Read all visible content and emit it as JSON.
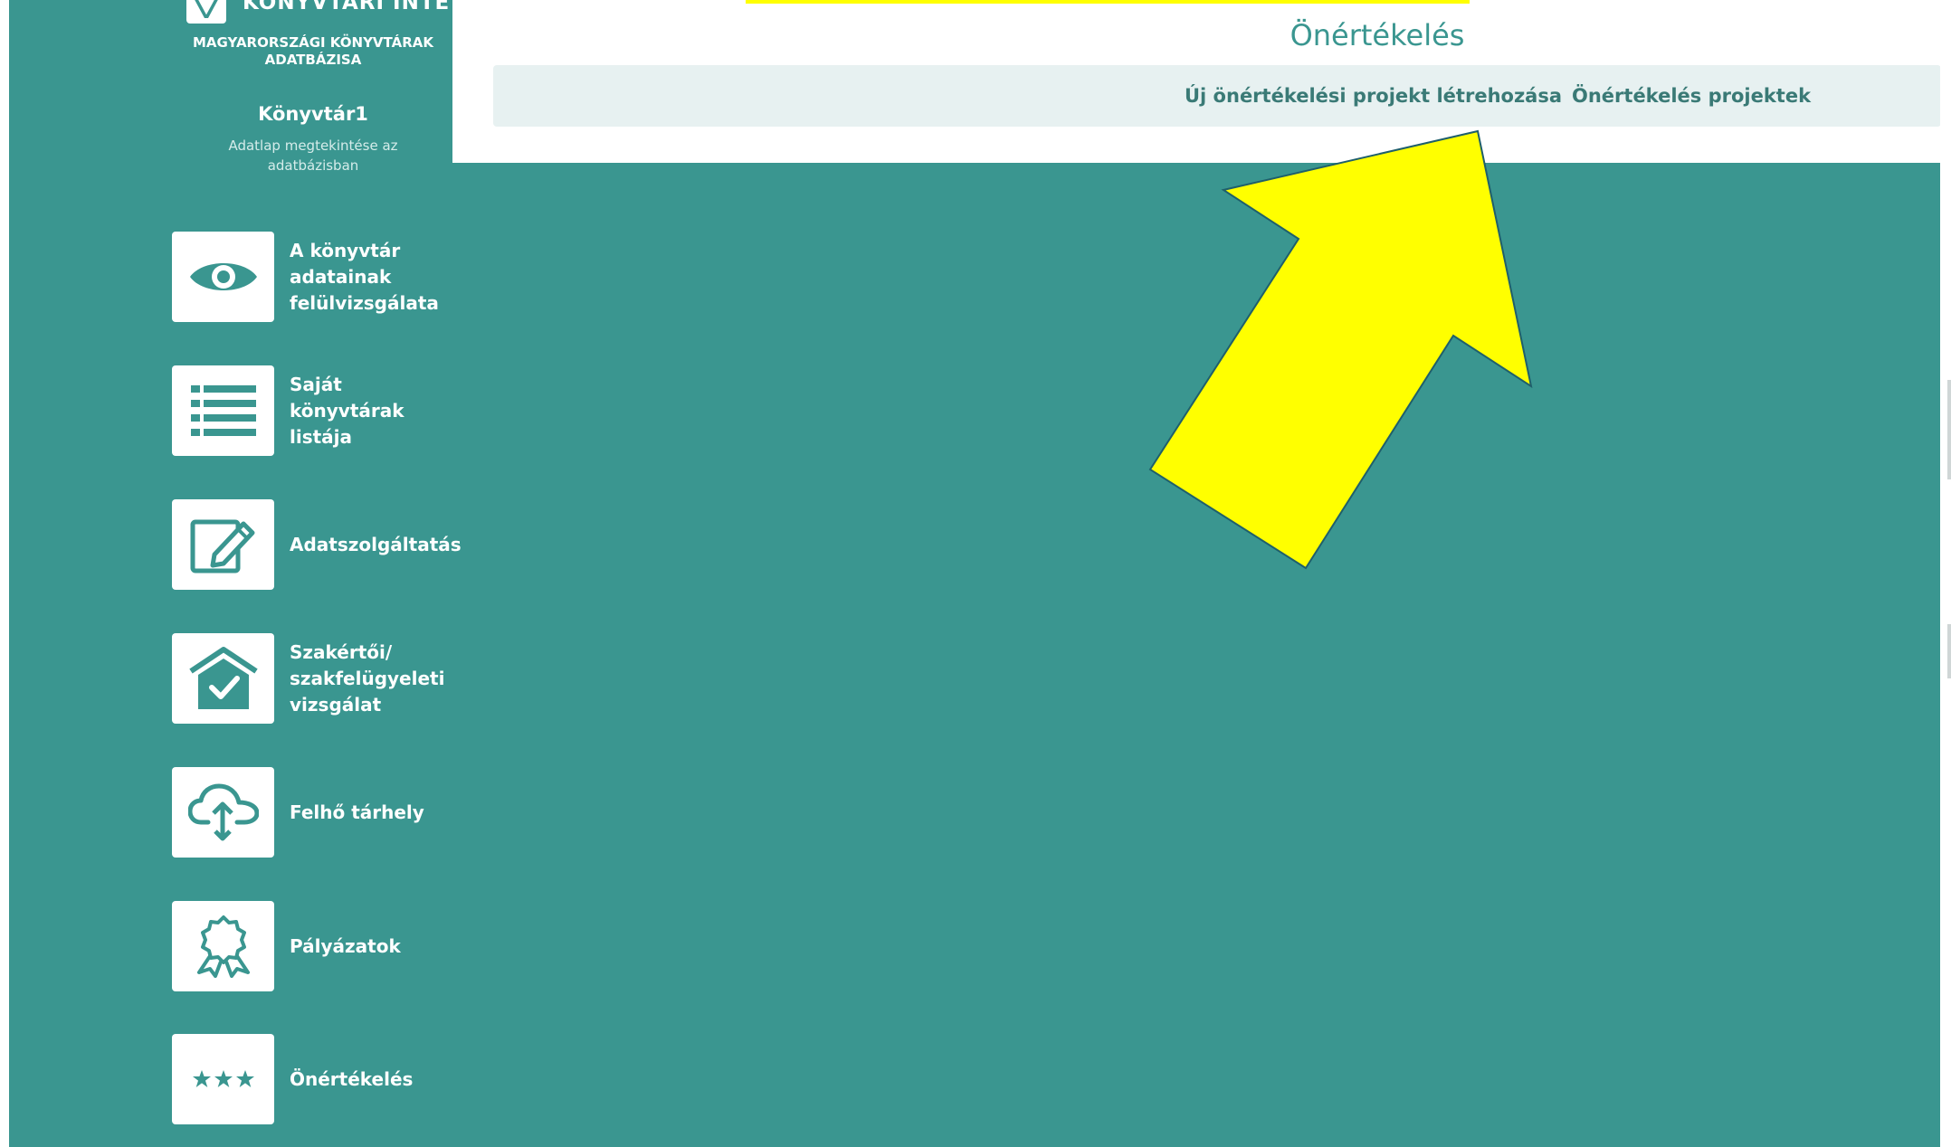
{
  "branding": {
    "institute_name": "KÖNYVTÁRI INTÉZET",
    "database_name": "MAGYARORSZÁGI KÖNYVTÁRAK\nADATBÁZISA"
  },
  "library": {
    "name": "Könyvtár1",
    "datasheet_link": "Adatlap megtekintése az\nadatbázisban"
  },
  "sidebar": {
    "items": [
      {
        "label": "A könyvtár\nadatainak\nfelülvizsgálata",
        "icon": "eye-icon"
      },
      {
        "label": "Saját\nkönyvtárak\nlistája",
        "icon": "list-icon"
      },
      {
        "label": "Adatszolgáltatás",
        "icon": "edit-document-icon"
      },
      {
        "label": "Szakértői/\nszakfelügyeleti\nvizsgálat",
        "icon": "house-check-icon"
      },
      {
        "label": "Felhő tárhely",
        "icon": "cloud-upload-icon"
      },
      {
        "label": "Pályázatok",
        "icon": "award-icon"
      },
      {
        "label": "Önértékelés",
        "icon": "three-stars-icon"
      }
    ]
  },
  "header": {
    "title": "Önértékelés",
    "subnav": [
      {
        "label": "Új önértékelési projekt létrehozása"
      },
      {
        "label": "Önértékelés projektek"
      }
    ]
  },
  "annotation": {
    "type": "arrow",
    "color": "#ffff00",
    "points_to": "Önértékelés projektek"
  },
  "colors": {
    "teal_background": "#3a9690",
    "header_background": "#ffffff",
    "subnav_background": "#e7f1f1",
    "title_text": "#3a9690",
    "subnav_text": "#3a7a76",
    "arrow_fill": "#ffff00"
  }
}
